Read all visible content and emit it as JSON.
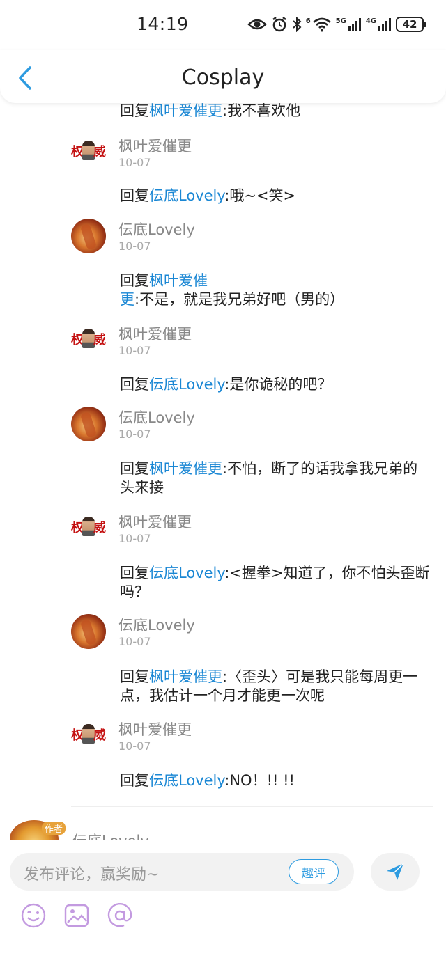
{
  "status": {
    "time": "14:19",
    "network_1": "6",
    "network_2": "5G",
    "network_3": "4G",
    "battery": "42"
  },
  "nav": {
    "title": "Cosplay"
  },
  "replies": [
    {
      "prefix": "回复",
      "mention": "枫叶爱催更",
      "body": ":我不喜欢他"
    },
    {
      "prefix": "回复",
      "mention": "伝底Lovely",
      "body": ":哦~<笑>"
    },
    {
      "prefix": "回复",
      "mention": "枫叶爱催更",
      "body": ":不是，就是我兄弟好吧（男的）"
    },
    {
      "prefix": "回复",
      "mention": "伝底Lovely",
      "body": ":是你诡秘的吧？"
    },
    {
      "prefix": "回复",
      "mention": "枫叶爱催更",
      "body": ":不怕，断了的话我拿我兄弟的头来接"
    },
    {
      "prefix": "回复",
      "mention": "伝底Lovely",
      "body": ":<握拳>知道了，你不怕头歪断吗？"
    },
    {
      "prefix": "回复",
      "mention": "枫叶爱催更",
      "body": ":〈歪头〉可是我只能每周更一点，我估计一个月才能更一次呢"
    },
    {
      "prefix": "回复",
      "mention": "伝底Lovely",
      "body": ":NO！!!  !!"
    }
  ],
  "authors": [
    {
      "name": "枫叶爱催更",
      "date": "10-07",
      "avatar_text_left": "权",
      "avatar_text_right": "威"
    },
    {
      "name": "伝底Lovely",
      "date": "10-07"
    },
    {
      "name": "枫叶爱催更",
      "date": "10-07",
      "avatar_text_left": "权",
      "avatar_text_right": "威"
    },
    {
      "name": "伝底Lovely",
      "date": "10-07"
    },
    {
      "name": "枫叶爱催更",
      "date": "10-07",
      "avatar_text_left": "权",
      "avatar_text_right": "威"
    },
    {
      "name": "伝底Lovely",
      "date": "10-07"
    },
    {
      "name": "枫叶爱催更",
      "date": "10-07",
      "avatar_text_left": "权",
      "avatar_text_right": "威"
    }
  ],
  "next_comment": {
    "name": "伝底Lovely",
    "badge": "作者"
  },
  "composer": {
    "placeholder": "发布评论，赢奖励~",
    "quping_label": "趣评"
  },
  "colors": {
    "mention": "#1a87d4",
    "accent": "#2d9be0",
    "muted": "#888888"
  }
}
